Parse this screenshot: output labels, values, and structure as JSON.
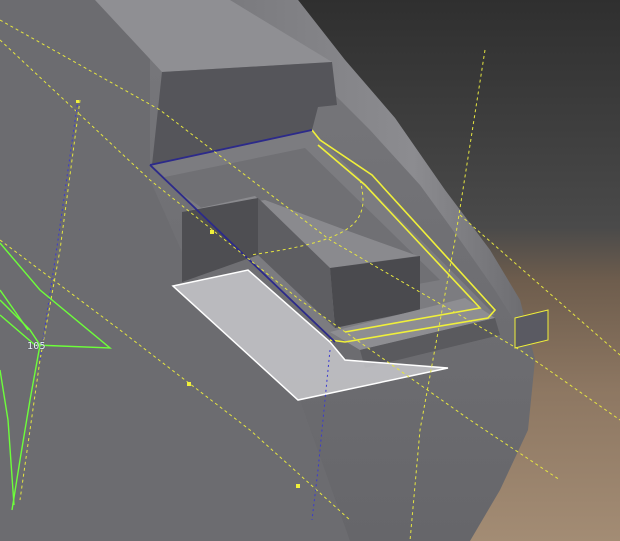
{
  "viewport": {
    "dimension_label": "105"
  },
  "colors": {
    "background_top": "#2f2f2f",
    "ground": "#8d7762",
    "body_gray": "#6e6e72",
    "body_light": "#8a8a8e",
    "recess_dark": "#4e4e52",
    "sketch_yellow": "#f0f03a",
    "sketch_blue": "#2c2a8a",
    "sketch_green": "#6dff3a",
    "selection_white": "#ffffff"
  }
}
